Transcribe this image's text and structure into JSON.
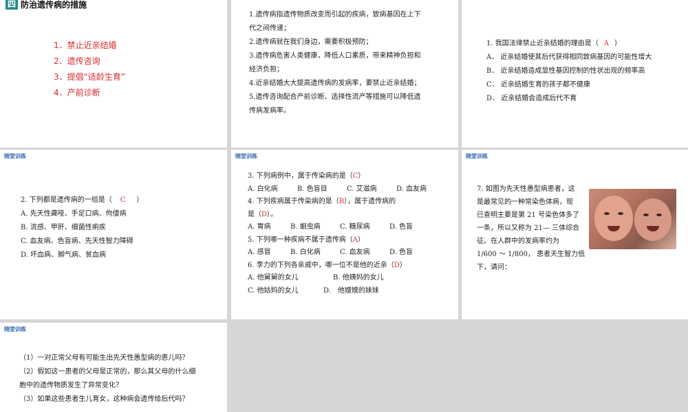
{
  "slide1": {
    "section_number": "四",
    "section_title": "防治遗传病的措施",
    "items": [
      "1．禁止近亲结婚",
      "2．遗传咨询",
      "3．提倡“适龄生育”",
      "4．产前诊断"
    ]
  },
  "slide2": {
    "lines": [
      "1.遗传病指遗传物质改变而引起的疾病，致病基因在上下",
      "代之间传递；",
      "2.遗传病就在我们身边，需要积极预防；",
      "3.遗传病危害人类健康，降低人口素质，带来精神负担和",
      "经济负担；",
      "4.近亲结婚大大提高遗传病的发病率，要禁止近亲结婚；",
      "5.遗传咨询配合产前诊断、选择性流产等措施可以降低遗",
      "传病发病率。"
    ]
  },
  "slide3": {
    "question_pre": "1. 我国法律禁止近亲结婚的理由是（",
    "answer": "A",
    "question_post": "）",
    "options": [
      "A． 近亲结婚使其后代获得相同致病基因的可能性增大",
      "B． 近亲结婚造成显性基因控制的性状出现的频率高",
      "C． 近亲结婚生育的孩子都不健康",
      "D． 近亲结婚会造成后代不育"
    ]
  },
  "slide4": {
    "tag": "随堂训练",
    "question_pre": "2. 下列都是遗传病的一组是（",
    "answer": "C",
    "question_post": "）",
    "options": [
      "A. 先天性聋哑、手足口病、佝偻病",
      "B. 流感、甲肝、细菌性痢疾",
      "C. 血友病、色盲病、先天性智力障碍",
      "D. 坏血病、脚气病、贫血病"
    ]
  },
  "slide5": {
    "tag": "随堂训练",
    "q3_pre": "3. 下列病例中，属于传染病的是（",
    "q3_ans": "C",
    "q3_post": "）",
    "q3_opts": [
      "A. 白化病",
      "B. 色盲目",
      "C. 艾滋病",
      "D. 血友病"
    ],
    "q4_pre": "4. 下列疾病属于传染病的是（",
    "q4_ans1": "B",
    "q4_mid": "），属于遗传病的",
    "q4_line2_pre": "是（",
    "q4_ans2": "D",
    "q4_post": "）。",
    "q4_opts": [
      "A. 胃病",
      "B. 蛔虫病",
      "C. 糖尿病",
      "D. 色盲"
    ],
    "q5_pre": "5. 下列哪一种疾病不属于遗传病（",
    "q5_ans": "A",
    "q5_post": "）",
    "q5_opts": [
      "A. 感冒",
      "B. 白化病",
      "C. 血友病",
      "D. 色盲"
    ],
    "q6_pre": "6. 李力的下列各亲戚中，哪一位不是他的近亲（",
    "q6_ans": "D",
    "q6_post": "）",
    "q6_opts": [
      "A. 他舅舅的女儿",
      "B. 他姨妈的女儿",
      "C. 他姑妈的女儿",
      "D.　他嫂嫂的妹妹"
    ]
  },
  "slide6": {
    "tag": "随堂训练",
    "lines": [
      "7. 如图为先天性愚型病患者，这",
      "是最常见的一种常染色体病，现",
      "已查明主要是第 21 号染色体多了",
      "一条，所以又称为 21— 三体综合",
      "征。在人群中的发病率约为",
      "1/600 ～ 1/800， 患者天生智力低",
      "下，请问："
    ]
  },
  "slide7": {
    "tag": "随堂训练",
    "lines": [
      "（1）一对正常父母有可能生出先天性愚型病的患儿吗？",
      "（2）假如这一患者的父母是正常的，那么其父母的什么细",
      "胞中的遗传物质发生了异常变化？",
      "（3）如果这些患者生儿育女，这种病会遗传给后代吗？"
    ]
  }
}
